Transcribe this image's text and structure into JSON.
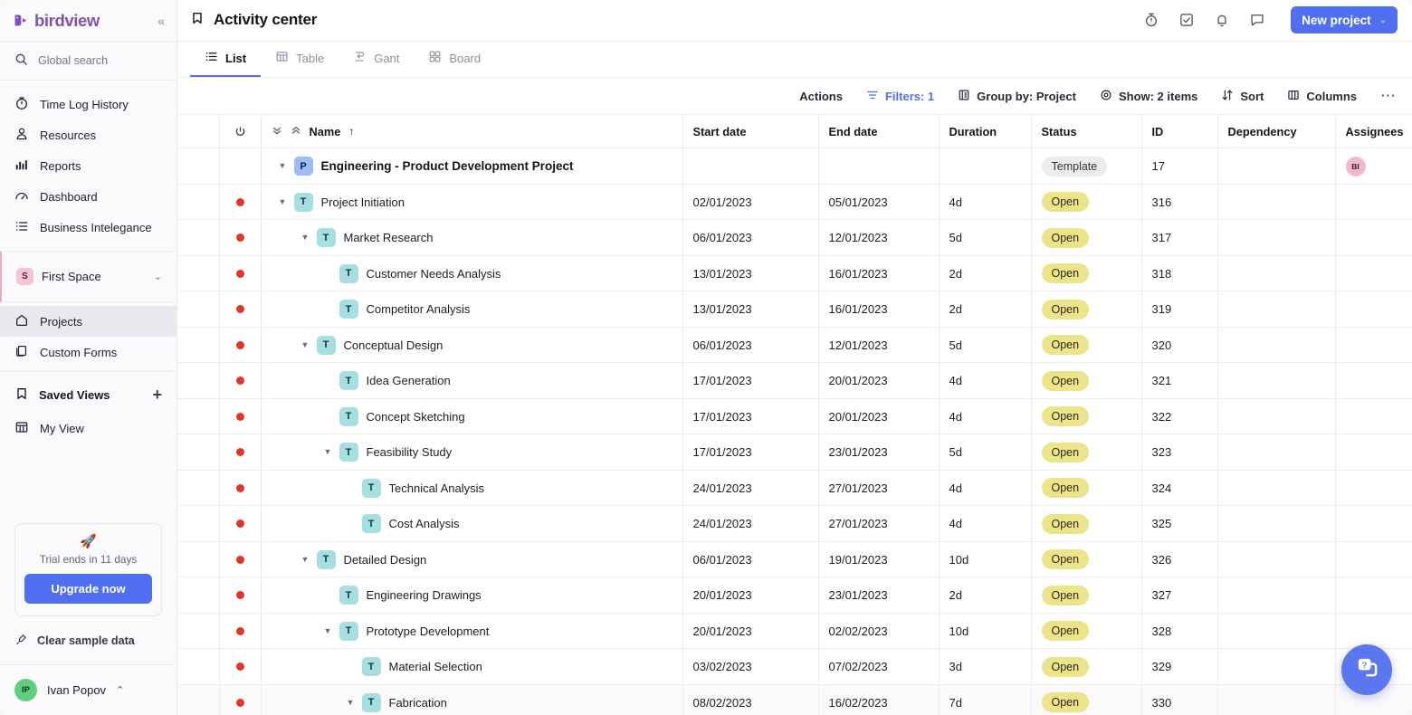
{
  "sidebar": {
    "brand": "birdview",
    "collapse_label": "«",
    "search_placeholder": "Global search",
    "nav": [
      {
        "label": "Time Log History",
        "icon": "timer-icon"
      },
      {
        "label": "Resources",
        "icon": "person-icon"
      },
      {
        "label": "Reports",
        "icon": "bar-chart-icon"
      },
      {
        "label": "Dashboard",
        "icon": "gauge-icon"
      },
      {
        "label": "Business Intelegance",
        "icon": "list-icon"
      }
    ],
    "space": {
      "badge": "S",
      "name": "First Space",
      "chevron": "⌄"
    },
    "space_items": [
      {
        "label": "Projects",
        "icon": "home-icon",
        "active": true
      },
      {
        "label": "Custom Forms",
        "icon": "forms-icon",
        "active": false
      }
    ],
    "saved_views": {
      "title": "Saved Views",
      "add_label": "+",
      "items": [
        {
          "label": "My View",
          "icon": "table-icon"
        }
      ]
    },
    "trial": {
      "icon": "rocket-icon",
      "text": "Trial ends in 11 days",
      "button": "Upgrade now"
    },
    "clear_sample": "Clear sample data",
    "user": {
      "initials": "IP",
      "name": "Ivan Popov",
      "chevron": "⌃"
    }
  },
  "header": {
    "title": "Activity center",
    "title_icon": "bookmark-icon",
    "icons": [
      "timer-icon",
      "checkbox-icon",
      "bell-icon",
      "chat-icon"
    ],
    "new_project": "New project",
    "new_project_caret": "⌄"
  },
  "tabs": [
    {
      "label": "List",
      "icon": "list-icon",
      "active": true
    },
    {
      "label": "Table",
      "icon": "table-icon",
      "active": false
    },
    {
      "label": "Gant",
      "icon": "gantt-icon",
      "active": false
    },
    {
      "label": "Board",
      "icon": "board-icon",
      "active": false
    }
  ],
  "toolbar": {
    "actions": "Actions",
    "filters": "Filters: 1",
    "group_by": "Group by: Project",
    "show": "Show: 2 items",
    "sort": "Sort",
    "columns": "Columns",
    "more": "⋯"
  },
  "table": {
    "columns": [
      "Name",
      "Start date",
      "End date",
      "Duration",
      "Status",
      "ID",
      "Dependency",
      "Assignees"
    ],
    "name_sort": "↑",
    "rows": [
      {
        "type": "project",
        "indent": 0,
        "caret": true,
        "badge": "P",
        "name": "Engineering - Product Development Project",
        "start": "",
        "end": "",
        "duration": "",
        "status": "Template",
        "id": "17",
        "dependency": "",
        "assignee": "BI",
        "flag": false
      },
      {
        "type": "task",
        "indent": 1,
        "caret": true,
        "badge": "T",
        "name": "Project Initiation",
        "start": "02/01/2023",
        "end": "05/01/2023",
        "duration": "4d",
        "status": "Open",
        "id": "316",
        "dependency": "",
        "assignee": "",
        "flag": true
      },
      {
        "type": "task",
        "indent": 2,
        "caret": true,
        "badge": "T",
        "name": "Market Research",
        "start": "06/01/2023",
        "end": "12/01/2023",
        "duration": "5d",
        "status": "Open",
        "id": "317",
        "dependency": "",
        "assignee": "",
        "flag": true
      },
      {
        "type": "task",
        "indent": 3,
        "caret": false,
        "badge": "T",
        "name": "Customer Needs Analysis",
        "start": "13/01/2023",
        "end": "16/01/2023",
        "duration": "2d",
        "status": "Open",
        "id": "318",
        "dependency": "",
        "assignee": "",
        "flag": true
      },
      {
        "type": "task",
        "indent": 3,
        "caret": false,
        "badge": "T",
        "name": "Competitor Analysis",
        "start": "13/01/2023",
        "end": "16/01/2023",
        "duration": "2d",
        "status": "Open",
        "id": "319",
        "dependency": "",
        "assignee": "",
        "flag": true
      },
      {
        "type": "task",
        "indent": 2,
        "caret": true,
        "badge": "T",
        "name": "Conceptual Design",
        "start": "06/01/2023",
        "end": "12/01/2023",
        "duration": "5d",
        "status": "Open",
        "id": "320",
        "dependency": "",
        "assignee": "",
        "flag": true
      },
      {
        "type": "task",
        "indent": 3,
        "caret": false,
        "badge": "T",
        "name": "Idea Generation",
        "start": "17/01/2023",
        "end": "20/01/2023",
        "duration": "4d",
        "status": "Open",
        "id": "321",
        "dependency": "",
        "assignee": "",
        "flag": true
      },
      {
        "type": "task",
        "indent": 3,
        "caret": false,
        "badge": "T",
        "name": "Concept Sketching",
        "start": "17/01/2023",
        "end": "20/01/2023",
        "duration": "4d",
        "status": "Open",
        "id": "322",
        "dependency": "",
        "assignee": "",
        "flag": true
      },
      {
        "type": "task",
        "indent": 3,
        "caret": true,
        "badge": "T",
        "name": "Feasibility Study",
        "start": "17/01/2023",
        "end": "23/01/2023",
        "duration": "5d",
        "status": "Open",
        "id": "323",
        "dependency": "",
        "assignee": "",
        "flag": true
      },
      {
        "type": "task",
        "indent": 4,
        "caret": false,
        "badge": "T",
        "name": "Technical Analysis",
        "start": "24/01/2023",
        "end": "27/01/2023",
        "duration": "4d",
        "status": "Open",
        "id": "324",
        "dependency": "",
        "assignee": "",
        "flag": true
      },
      {
        "type": "task",
        "indent": 4,
        "caret": false,
        "badge": "T",
        "name": "Cost Analysis",
        "start": "24/01/2023",
        "end": "27/01/2023",
        "duration": "4d",
        "status": "Open",
        "id": "325",
        "dependency": "",
        "assignee": "",
        "flag": true
      },
      {
        "type": "task",
        "indent": 2,
        "caret": true,
        "badge": "T",
        "name": "Detailed Design",
        "start": "06/01/2023",
        "end": "19/01/2023",
        "duration": "10d",
        "status": "Open",
        "id": "326",
        "dependency": "",
        "assignee": "",
        "flag": true
      },
      {
        "type": "task",
        "indent": 3,
        "caret": false,
        "badge": "T",
        "name": "Engineering Drawings",
        "start": "20/01/2023",
        "end": "23/01/2023",
        "duration": "2d",
        "status": "Open",
        "id": "327",
        "dependency": "",
        "assignee": "",
        "flag": true
      },
      {
        "type": "task",
        "indent": 3,
        "caret": true,
        "badge": "T",
        "name": "Prototype Development",
        "start": "20/01/2023",
        "end": "02/02/2023",
        "duration": "10d",
        "status": "Open",
        "id": "328",
        "dependency": "",
        "assignee": "",
        "flag": true
      },
      {
        "type": "task",
        "indent": 4,
        "caret": false,
        "badge": "T",
        "name": "Material Selection",
        "start": "03/02/2023",
        "end": "07/02/2023",
        "duration": "3d",
        "status": "Open",
        "id": "329",
        "dependency": "",
        "assignee": "",
        "flag": true
      },
      {
        "type": "task",
        "indent": 4,
        "caret": true,
        "badge": "T",
        "name": "Fabrication",
        "start": "08/02/2023",
        "end": "16/02/2023",
        "duration": "7d",
        "status": "Open",
        "id": "330",
        "dependency": "",
        "assignee": "",
        "flag": true
      }
    ]
  },
  "help": {
    "icon": "help-chat-icon"
  }
}
